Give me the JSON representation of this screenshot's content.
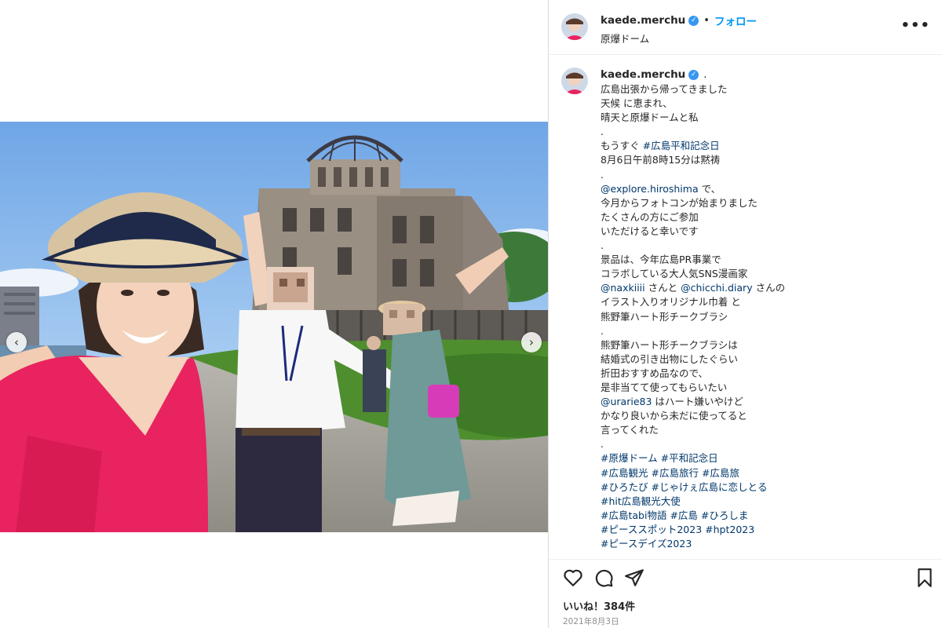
{
  "post": {
    "username": "kaede.merchu",
    "follow_label": "フォロー",
    "header_separator": "•",
    "location": "原爆ドーム",
    "more_icon": "more-horizontal-icon",
    "caption_user_suffix": ".",
    "caption_lines": [
      "広島出張から帰ってきました",
      "天候 に恵まれ、",
      "晴天と原爆ドームと私",
      ".",
      "もうすぐ #広島平和記念日",
      "8月6日午前8時15分は黙祷",
      ".",
      "@explore.hiroshima で、",
      "今月からフォトコンが始まりました",
      "たくさんの方にご参加",
      "いただけると幸いです",
      ".",
      "景品は、今年広島PR事業で",
      "コラボしている大人気SNS漫画家",
      "@naxkiiii さんと @chicchi.diary さんの",
      "イラスト入りオリジナル巾着 と",
      "熊野筆ハート形チークブラシ",
      ".",
      "熊野筆ハート形チークブラシは",
      "結婚式の引き出物にしたぐらい",
      "折田おすすめ品なので、",
      "是非当てて使ってもらいたい",
      "@urarie83 はハート嫌いやけど",
      "かなり良いから未だに使ってると",
      "言ってくれた",
      ".",
      "#原爆ドーム #平和記念日",
      "#広島観光 #広島旅行 #広島旅",
      "#ひろたび #じゃけぇ広島に恋しとる",
      "#hit広島観光大使",
      "#広島tabi物語 #広島 #ひろしま",
      "#ピーススポット2023 #hpt2023",
      "#ピースデイズ2023"
    ],
    "likes_text": "いいね！384件",
    "date_text": "2021年8月3日"
  },
  "media": {
    "description_icons": [
      "carousel-prev-icon",
      "carousel-next-icon"
    ],
    "prev_glyph": "‹",
    "next_glyph": "›"
  },
  "colors": {
    "link": "#00376b",
    "follow": "#0095f6",
    "verified": "#3797f0",
    "muted": "#8e8e8e"
  }
}
